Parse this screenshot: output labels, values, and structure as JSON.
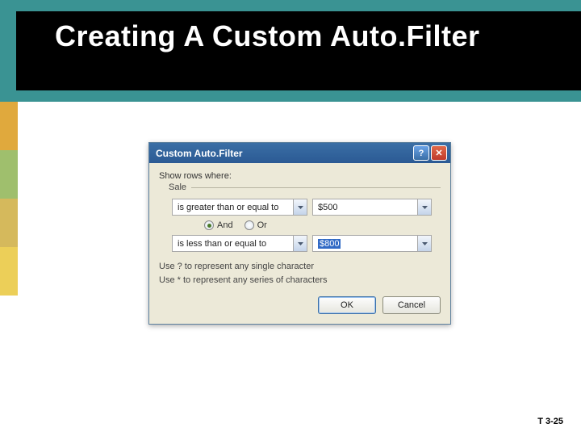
{
  "slide": {
    "title": "Creating A Custom Auto.Filter",
    "page_number": "T 3-25"
  },
  "dialog": {
    "title": "Custom Auto.Filter",
    "prompt": "Show rows where:",
    "field_label": "Sale",
    "row1": {
      "operator": "is greater than or equal to",
      "value": "$500"
    },
    "logic": {
      "and_label": "And",
      "or_label": "Or",
      "selected": "and"
    },
    "row2": {
      "operator": "is less than or equal to",
      "value": "$800"
    },
    "hint1": "Use ? to represent any single character",
    "hint2": "Use * to represent any series of characters",
    "ok_label": "OK",
    "cancel_label": "Cancel"
  }
}
